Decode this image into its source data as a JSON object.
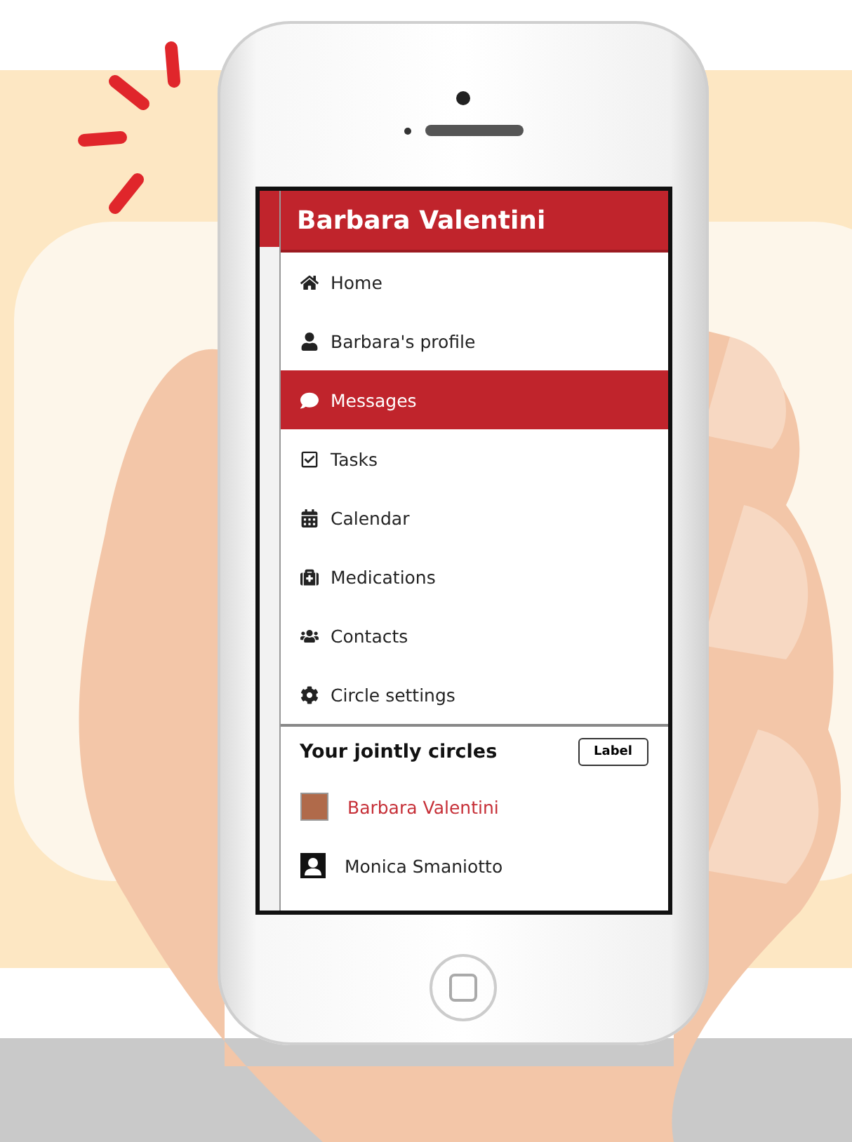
{
  "header": {
    "title": "Barbara Valentini"
  },
  "menu": [
    {
      "label": "Home",
      "selected": false
    },
    {
      "label": "Barbara's profile",
      "selected": false
    },
    {
      "label": "Messages",
      "selected": true
    },
    {
      "label": "Tasks",
      "selected": false
    },
    {
      "label": "Calendar",
      "selected": false
    },
    {
      "label": "Medications",
      "selected": false
    },
    {
      "label": "Contacts",
      "selected": false
    },
    {
      "label": "Circle settings",
      "selected": false
    }
  ],
  "circles": {
    "title": "Your jointly circles",
    "button": "Label",
    "items": [
      {
        "name": "Barbara Valentini",
        "selected": true,
        "kind": "photo"
      },
      {
        "name": "Monica Smaniotto",
        "selected": false,
        "kind": "silhouette"
      }
    ]
  }
}
